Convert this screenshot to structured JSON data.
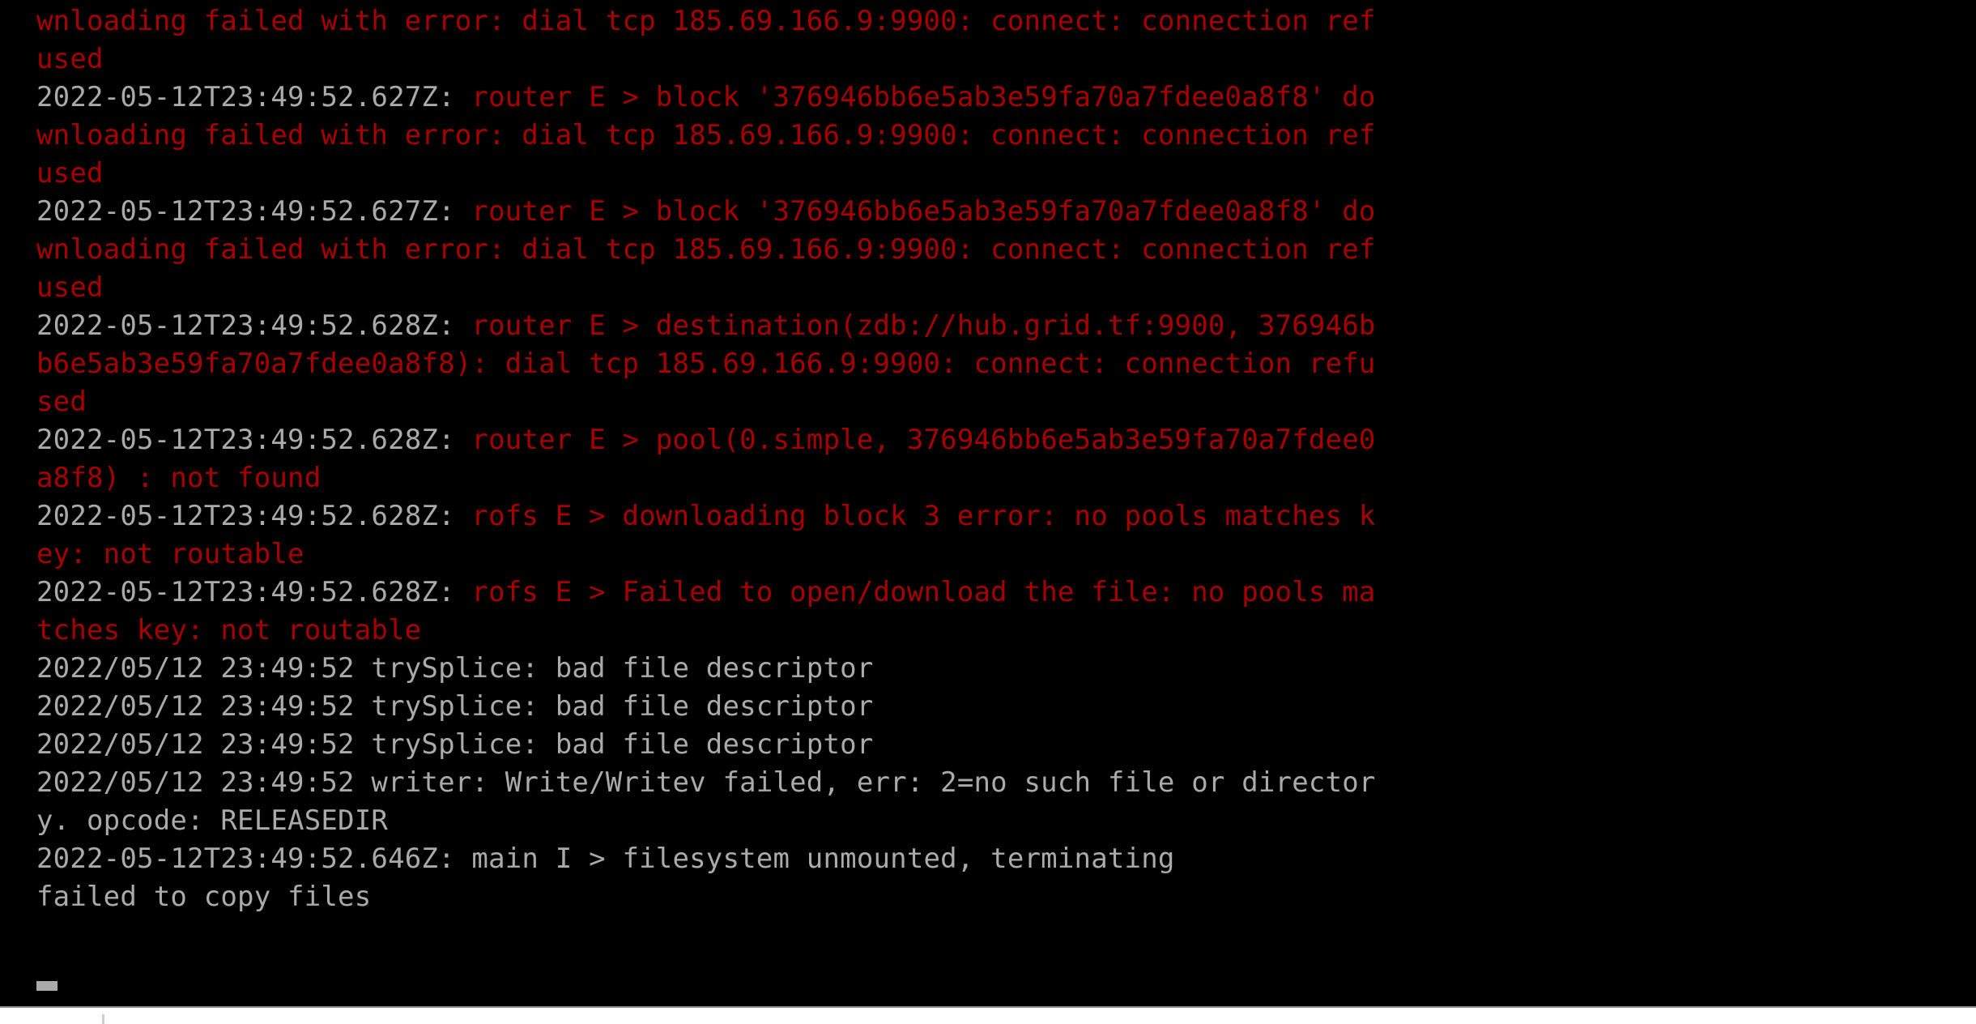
{
  "terminal": {
    "background_color": "#000000",
    "error_color": "#a80000",
    "normal_color": "#aaaaaa",
    "cursor": "_",
    "lines": [
      {
        "id": "line-01",
        "color": "error",
        "text": "wnloading failed with error: dial tcp 185.69.166.9:9900: connect: connection ref"
      },
      {
        "id": "line-02",
        "color": "error",
        "text": "used"
      },
      {
        "id": "line-03",
        "color": "mixed",
        "timestamp": "2022-05-12T23:49:52.627Z:",
        "message": " router E > block '376946bb6e5ab3e59fa70a7fdee0a8f8' do"
      },
      {
        "id": "line-04",
        "color": "error",
        "text": "wnloading failed with error: dial tcp 185.69.166.9:9900: connect: connection ref"
      },
      {
        "id": "line-05",
        "color": "error",
        "text": "used"
      },
      {
        "id": "line-06",
        "color": "mixed",
        "timestamp": "2022-05-12T23:49:52.627Z:",
        "message": " router E > block '376946bb6e5ab3e59fa70a7fdee0a8f8' do"
      },
      {
        "id": "line-07",
        "color": "error",
        "text": "wnloading failed with error: dial tcp 185.69.166.9:9900: connect: connection ref"
      },
      {
        "id": "line-08",
        "color": "error",
        "text": "used"
      },
      {
        "id": "line-09",
        "color": "mixed",
        "timestamp": "2022-05-12T23:49:52.628Z:",
        "message": " router E > destination(zdb://hub.grid.tf:9900, 376946b"
      },
      {
        "id": "line-10",
        "color": "error",
        "text": "b6e5ab3e59fa70a7fdee0a8f8): dial tcp 185.69.166.9:9900: connect: connection refu"
      },
      {
        "id": "line-11",
        "color": "error",
        "text": "sed"
      },
      {
        "id": "line-12",
        "color": "mixed",
        "timestamp": "2022-05-12T23:49:52.628Z:",
        "message": " router E > pool(0.simple, 376946bb6e5ab3e59fa70a7fdee0"
      },
      {
        "id": "line-13",
        "color": "error",
        "text": "a8f8) : not found"
      },
      {
        "id": "line-14",
        "color": "mixed",
        "timestamp": "2022-05-12T23:49:52.628Z:",
        "message": " rofs E > downloading block 3 error: no pools matches k"
      },
      {
        "id": "line-15",
        "color": "error",
        "text": "ey: not routable"
      },
      {
        "id": "line-16",
        "color": "mixed",
        "timestamp": "2022-05-12T23:49:52.628Z:",
        "message": " rofs E > Failed to open/download the file: no pools ma"
      },
      {
        "id": "line-17",
        "color": "error",
        "text": "tches key: not routable"
      },
      {
        "id": "line-18",
        "color": "normal",
        "text": "2022/05/12 23:49:52 trySplice: bad file descriptor"
      },
      {
        "id": "line-19",
        "color": "normal",
        "text": "2022/05/12 23:49:52 trySplice: bad file descriptor"
      },
      {
        "id": "line-20",
        "color": "normal",
        "text": "2022/05/12 23:49:52 trySplice: bad file descriptor"
      },
      {
        "id": "line-21",
        "color": "normal",
        "text": "2022/05/12 23:49:52 writer: Write/Writev failed, err: 2=no such file or director"
      },
      {
        "id": "line-22",
        "color": "normal",
        "text": "y. opcode: RELEASEDIR"
      },
      {
        "id": "line-23",
        "color": "normal",
        "text": "2022-05-12T23:49:52.646Z: main I > filesystem unmounted, terminating"
      },
      {
        "id": "line-24",
        "color": "normal",
        "text": "failed to copy files"
      },
      {
        "id": "line-25",
        "color": "normal",
        "text": ""
      }
    ]
  }
}
